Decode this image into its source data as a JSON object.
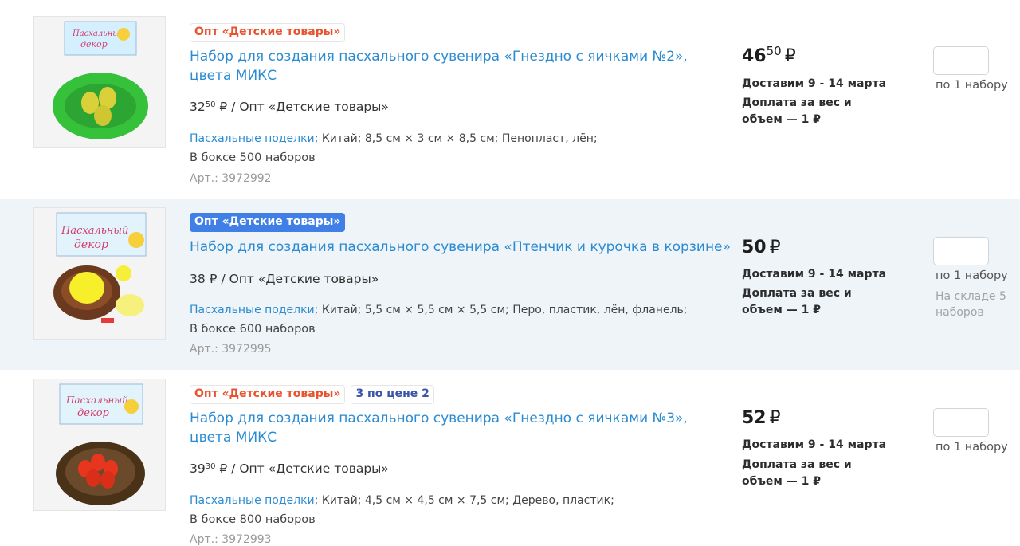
{
  "products": [
    {
      "badges": [
        {
          "label": "Опт «Детские товары»"
        }
      ],
      "title": "Набор для создания пасхального сувенира «Гнездно с яичками №2», цвета МИКС",
      "opt_price_main": "32",
      "opt_price_sup": "50",
      "opt_price_rest": " ₽ / Опт «Детские товары»",
      "category": "Пасхальные поделки",
      "props": "; Китай; 8,5 см × 3 см × 8,5 см; Пенопласт, лён;",
      "box": "В боксе 500 наборов",
      "art": "Арт.: 3972992",
      "price_main": "46",
      "price_sup": "50",
      "currency": "₽",
      "delivery": "Доставим 9 - 14 марта",
      "extra_charge": "Доплата за вес и объем — 1 ₽",
      "per_unit": "по 1 набору",
      "qty_value": ""
    },
    {
      "badges": [
        {
          "label": "Опт «Детские товары»"
        }
      ],
      "title": "Набор для создания пасхального сувенира «Птенчик и курочка в корзине»",
      "opt_price_main": "38",
      "opt_price_sup": "",
      "opt_price_rest": " ₽ / Опт «Детские товары»",
      "category": "Пасхальные поделки",
      "props": "; Китай; 5,5 см × 5,5 см × 5,5 см; Перо, пластик, лён, фланель;",
      "box": "В боксе 600 наборов",
      "art": "Арт.: 3972995",
      "price_main": "50",
      "price_sup": "",
      "currency": "₽",
      "delivery": "Доставим 9 - 14 марта",
      "extra_charge": "Доплата за вес и объем — 1 ₽",
      "per_unit": "по 1 набору",
      "stock": "На складе 5 наборов",
      "qty_value": ""
    },
    {
      "badges": [
        {
          "label": "Опт «Детские товары»"
        },
        {
          "label": "3 по цене 2"
        }
      ],
      "title": "Набор для создания пасхального сувенира «Гнездно с яичками №3», цвета МИКС",
      "opt_price_main": "39",
      "opt_price_sup": "30",
      "opt_price_rest": " ₽ / Опт «Детские товары»",
      "category": "Пасхальные поделки",
      "props": "; Китай; 4,5 см × 4,5 см × 7,5 см; Дерево, пластик;",
      "box": "В боксе 800 наборов",
      "art": "Арт.: 3972993",
      "price_main": "52",
      "price_sup": "",
      "currency": "₽",
      "delivery": "Доставим 9 - 14 марта",
      "extra_charge": "Доплата за вес и объем — 1 ₽",
      "per_unit": "по 1 набору",
      "qty_value": ""
    }
  ],
  "colors": {
    "link": "#2a8bd2",
    "badge_red": "#e8532e",
    "badge_blue": "#3a55a8",
    "selection": "#3f7fe6",
    "row_alt_bg": "#eef4f7"
  },
  "icons": [
    "easter-nest-product-image",
    "chick-nest-product-image",
    "red-eggs-nest-product-image"
  ]
}
